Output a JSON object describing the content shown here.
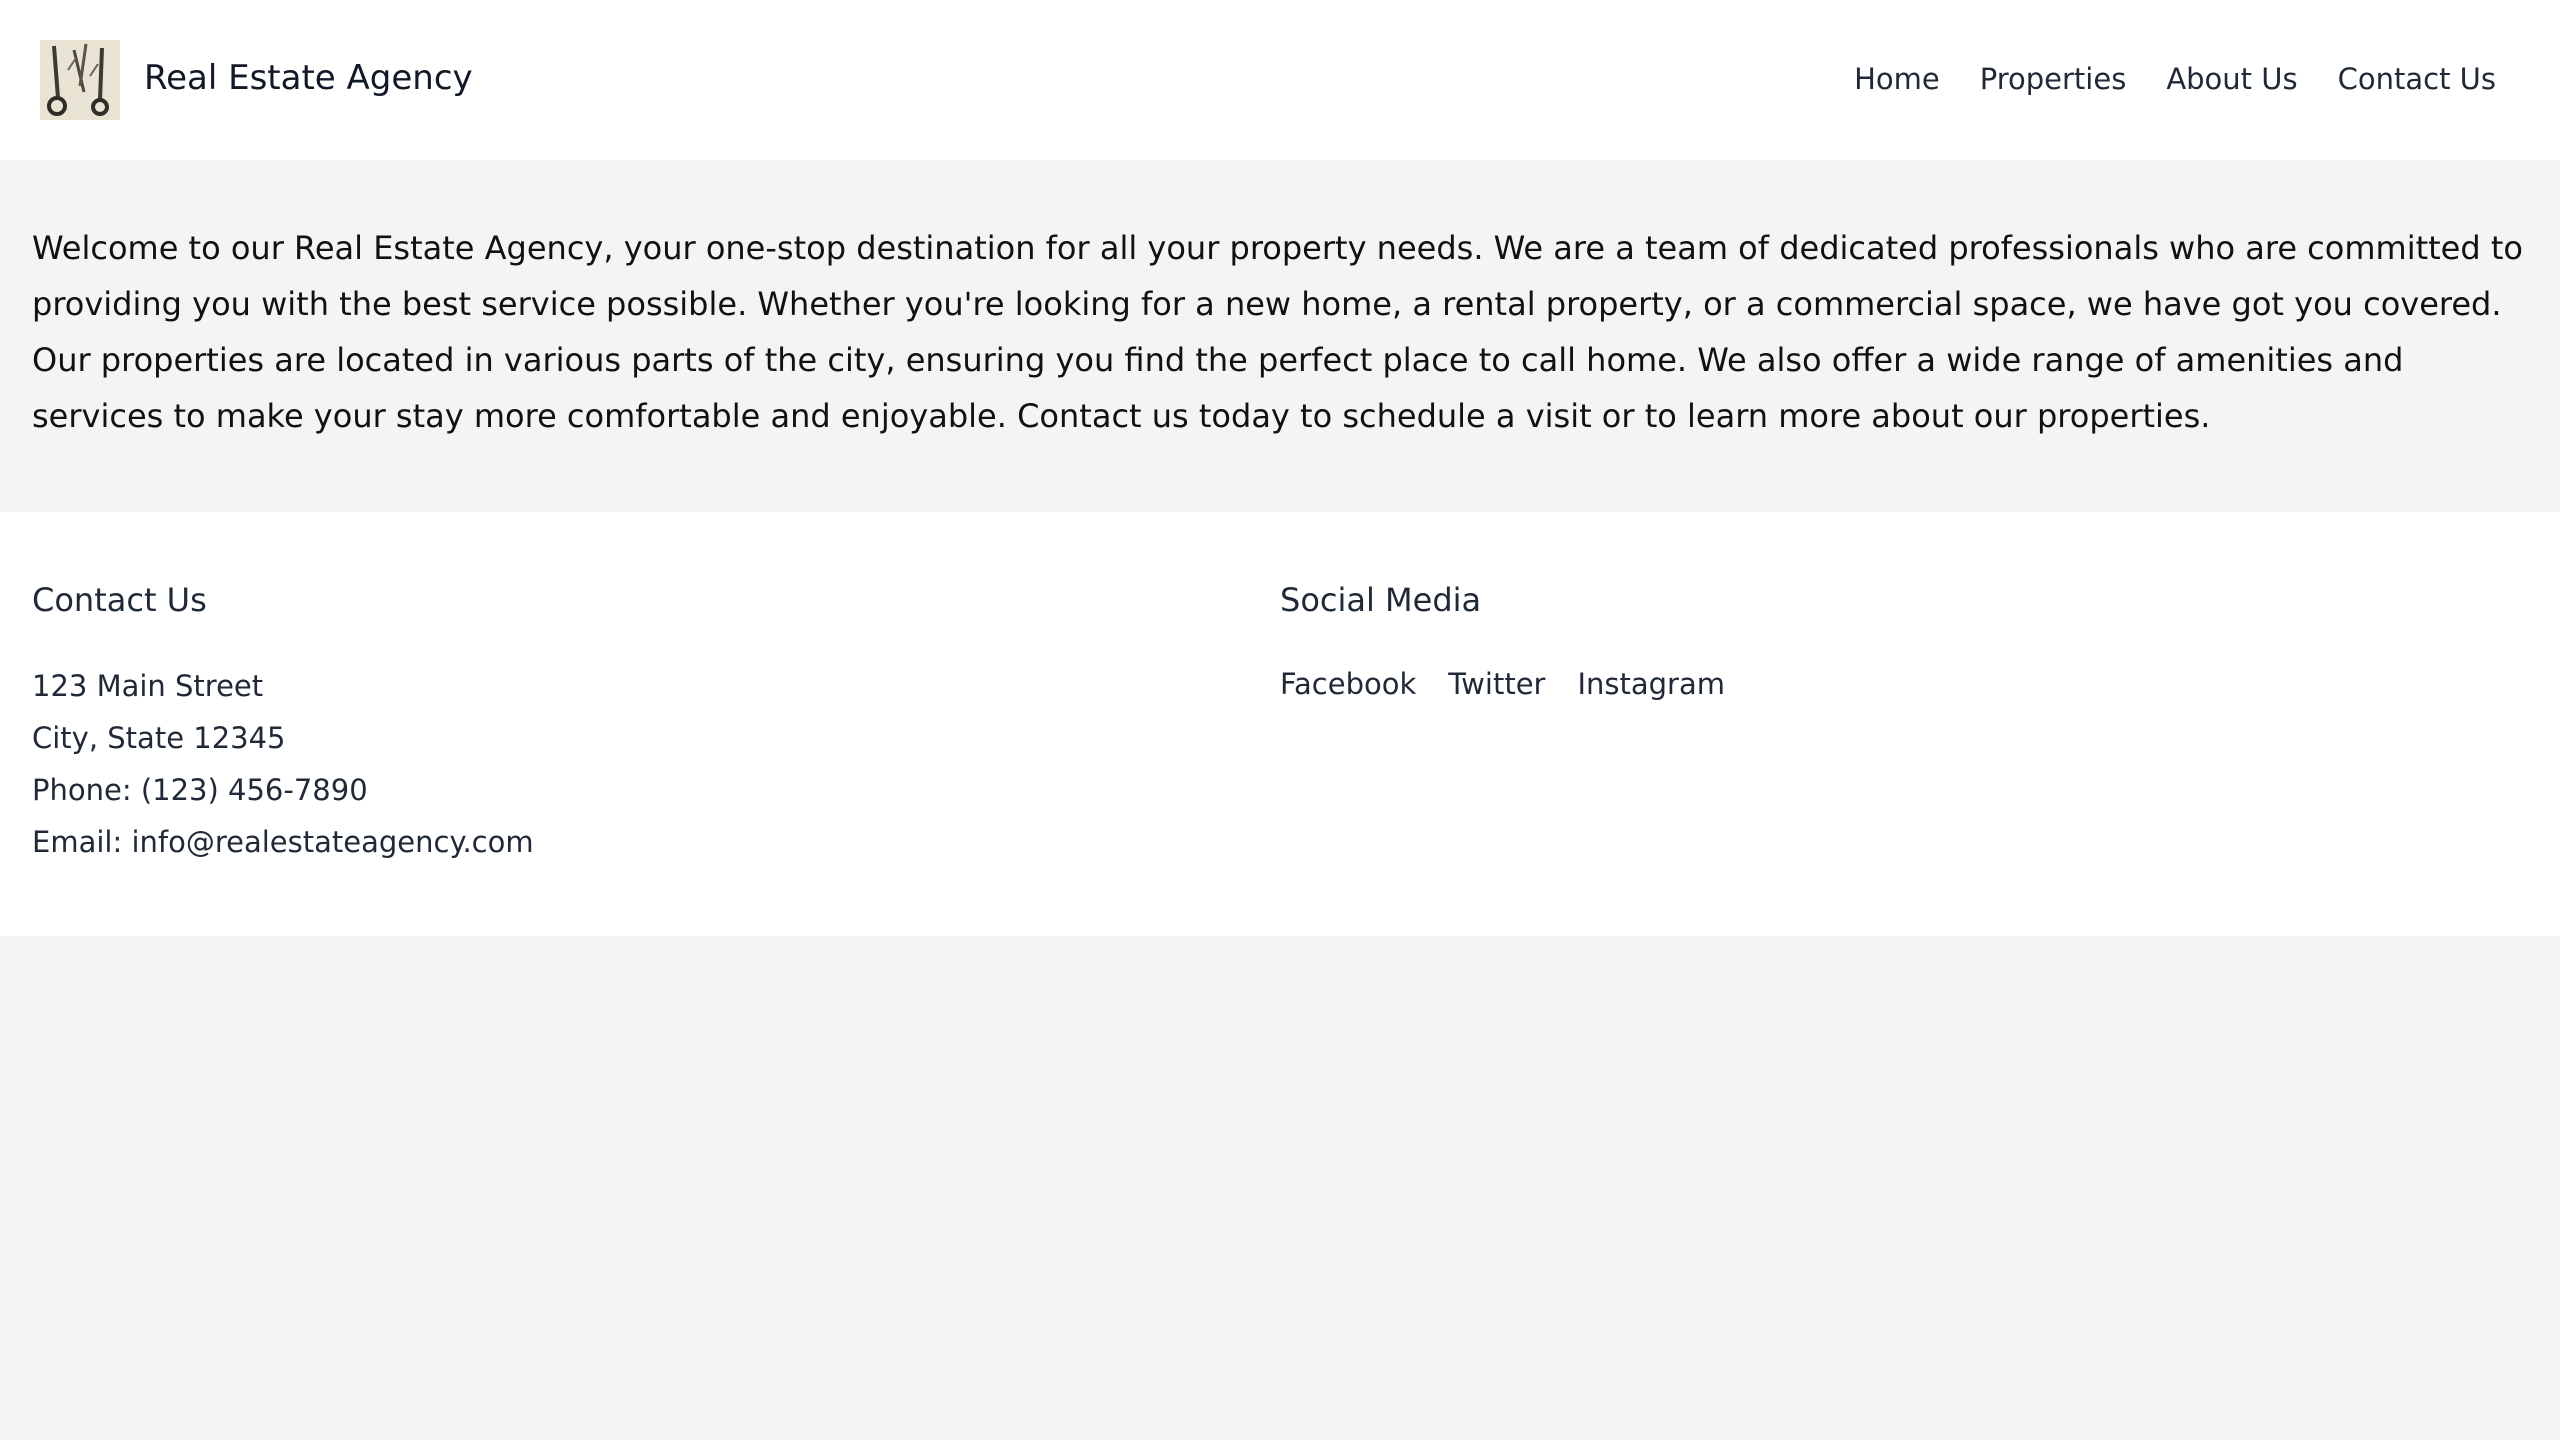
{
  "header": {
    "logo_icon": "keys-photo-logo",
    "brand": "Real Estate Agency",
    "nav": [
      "Home",
      "Properties",
      "About Us",
      "Contact Us"
    ]
  },
  "intro": {
    "text": "Welcome to our Real Estate Agency, your one-stop destination for all your property needs. We are a team of dedicated professionals who are committed to providing you with the best service possible. Whether you're looking for a new home, a rental property, or a commercial space, we have got you covered. Our properties are located in various parts of the city, ensuring you find the perfect place to call home. We also offer a wide range of amenities and services to make your stay more comfortable and enjoyable. Contact us today to schedule a visit or to learn more about our properties."
  },
  "footer": {
    "contact": {
      "heading": "Contact Us",
      "lines": [
        "123 Main Street",
        "City, State 12345",
        "Phone: (123) 456-7890",
        "Email: info@realestateagency.com"
      ]
    },
    "social": {
      "heading": "Social Media",
      "links": [
        "Facebook",
        "Twitter",
        "Instagram"
      ]
    }
  },
  "colors": {
    "page_background": "#f3f4f6",
    "surface": "#ffffff",
    "text": "#1f2937"
  }
}
